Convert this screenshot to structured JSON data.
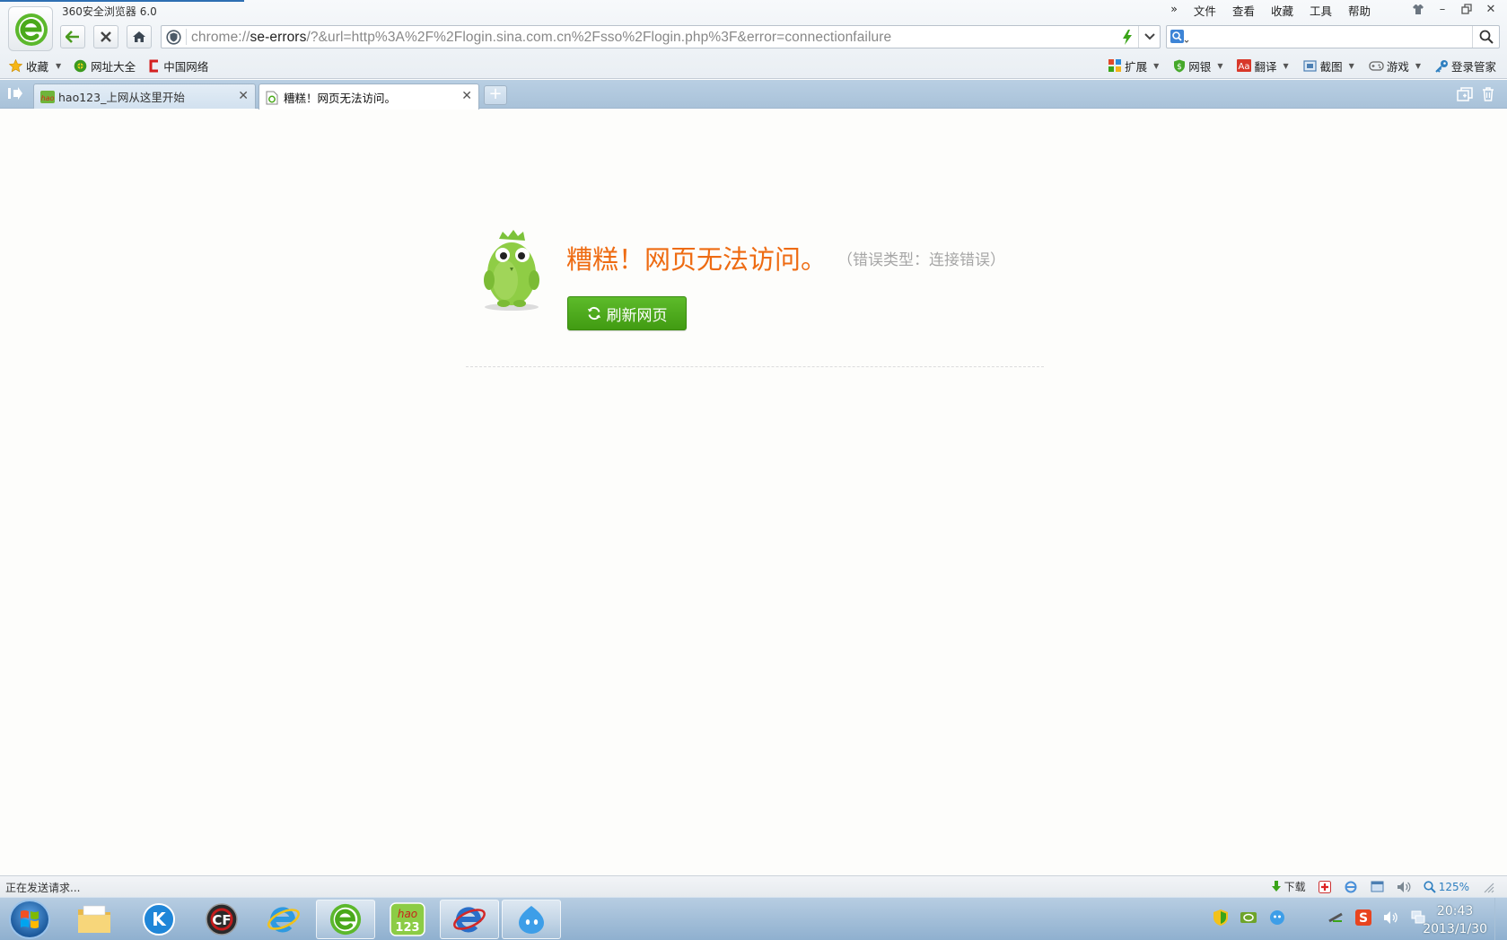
{
  "window": {
    "title": "360安全浏览器 6.0"
  },
  "menu": {
    "overflow": "»",
    "items": [
      "文件",
      "查看",
      "收藏",
      "工具",
      "帮助"
    ]
  },
  "window_controls": {
    "skin_icon": "shirt-icon",
    "minimize": "–",
    "restore": "🗗",
    "close": "✕"
  },
  "address": {
    "scheme": "chrome://",
    "host": "se-errors",
    "rest": "/?&url=http%3A%2F%2Flogin.sina.com.cn%2Fsso%2Flogin.php%3F&error=connectionfailure"
  },
  "search": {
    "value": ""
  },
  "bookmarks": [
    {
      "label": "收藏",
      "icon": "star-icon"
    },
    {
      "label": "网址大全",
      "icon": "globe-icon"
    },
    {
      "label": "中国网络",
      "icon": "c-logo-icon"
    }
  ],
  "toolbar": [
    {
      "label": "扩展",
      "icon": "extensions-icon"
    },
    {
      "label": "网银",
      "icon": "bank-shield-icon"
    },
    {
      "label": "翻译",
      "icon": "translate-icon"
    },
    {
      "label": "截图",
      "icon": "screenshot-icon"
    },
    {
      "label": "游戏",
      "icon": "gamepad-icon"
    },
    {
      "label": "登录管家",
      "icon": "key-icon"
    }
  ],
  "tabs": [
    {
      "label": "hao123_上网从这里开始",
      "active": false
    },
    {
      "label": "糟糕！网页无法访问。",
      "active": true
    }
  ],
  "new_tab": "+",
  "error": {
    "title": "糟糕！网页无法访问。",
    "type": "（错误类型：连接错误）",
    "refresh_label": "刷新网页"
  },
  "status": {
    "text": "正在发送请求...",
    "download": "下载",
    "zoom": "125%"
  },
  "taskbar": {
    "apps": [
      "explorer",
      "kugou",
      "crossfire",
      "internet-explorer",
      "360-browser",
      "hao123",
      "ie-app",
      "qq-client"
    ],
    "time": "20:43",
    "date": "2013/1/30"
  },
  "colors": {
    "accent": "#ee6b12",
    "button": "#4aa91a",
    "link": "#2e7fc0"
  }
}
